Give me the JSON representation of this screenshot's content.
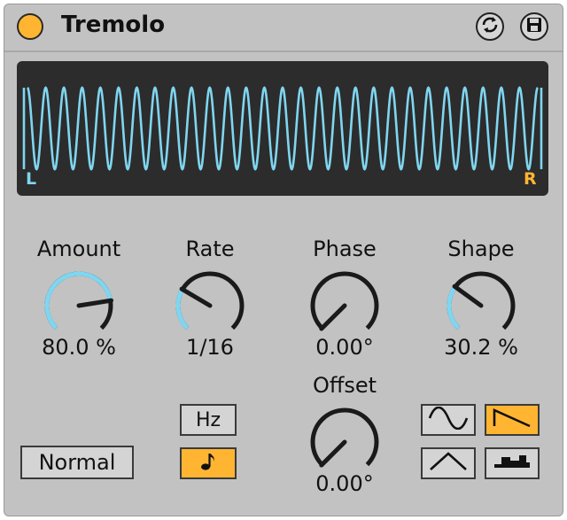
{
  "device": {
    "title": "Tremolo",
    "power_on": true
  },
  "header": {
    "hot_swap_icon": "hot-swap-icon",
    "save_icon": "save-preset-icon"
  },
  "display": {
    "left_label": "L",
    "right_label": "R",
    "cycles": 28,
    "colors": {
      "waveform": "#7fd6f0",
      "left_label": "#7fd6f0",
      "right_label": "#ffb532",
      "background": "#2c2c2c"
    }
  },
  "knobs": {
    "amount": {
      "label": "Amount",
      "value": "80.0 %",
      "fraction": 0.8
    },
    "rate": {
      "label": "Rate",
      "value": "1/16",
      "fraction": 0.28
    },
    "phase": {
      "label": "Phase",
      "value": "0.00°",
      "fraction": 0.0
    },
    "shape": {
      "label": "Shape",
      "value": "30.2 %",
      "fraction": 0.3
    },
    "offset": {
      "label": "Offset",
      "value": "0.00°",
      "fraction": 0.0
    }
  },
  "rate_mode": {
    "hz_label": "Hz",
    "sync_icon": "music-note-icon",
    "selected": "sync"
  },
  "stereo_mode": {
    "value": "Normal"
  },
  "waveforms": {
    "sine_icon": "sine-wave-icon",
    "saw_icon": "saw-down-wave-icon",
    "triangle_icon": "triangle-wave-icon",
    "random_icon": "random-step-icon",
    "selected": "saw"
  },
  "colors": {
    "accent": "#ffb532",
    "arc": "#7fd6f0",
    "panel": "#c2c2c2"
  }
}
